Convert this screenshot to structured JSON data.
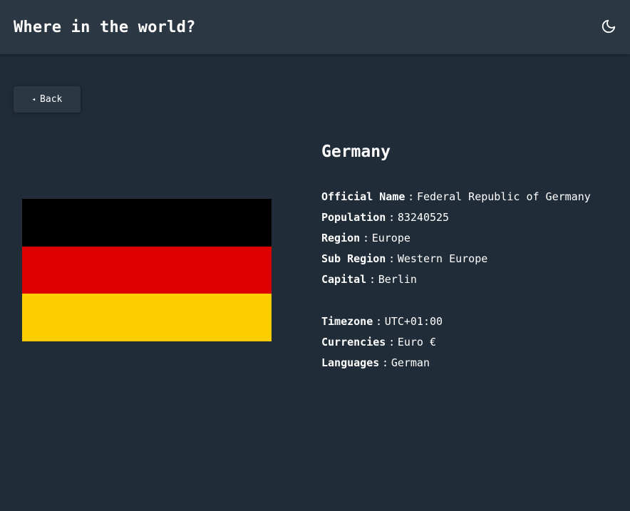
{
  "header": {
    "title": "Where in the world?",
    "theme_icon": "moon-icon"
  },
  "back": {
    "arrow": "◂",
    "label": "Back"
  },
  "flag": {
    "colors": [
      "#000000",
      "#dd0000",
      "#ffce00"
    ]
  },
  "country": {
    "name": "Germany",
    "sep": ":",
    "details_primary": [
      {
        "label": "Official Name",
        "value": "Federal Republic of Germany"
      },
      {
        "label": "Population",
        "value": "83240525"
      },
      {
        "label": "Region",
        "value": "Europe"
      },
      {
        "label": "Sub Region",
        "value": "Western Europe"
      },
      {
        "label": "Capital",
        "value": "Berlin"
      }
    ],
    "details_secondary": [
      {
        "label": "Timezone",
        "value": "UTC+01:00"
      },
      {
        "label": "Currencies",
        "value": "Euro €"
      },
      {
        "label": "Languages",
        "value": "German"
      }
    ]
  }
}
